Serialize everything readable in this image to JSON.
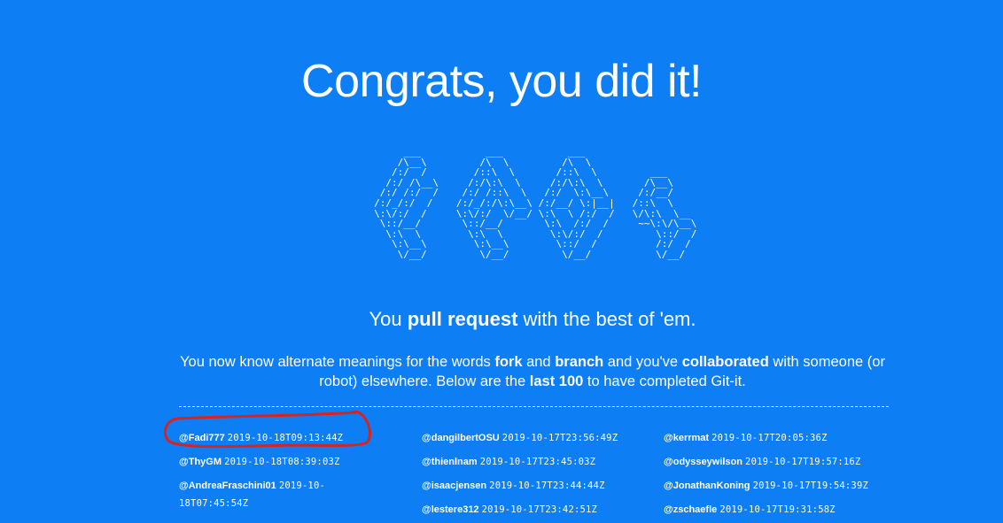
{
  "title": "Congrats, you did it!",
  "ascii_art": "      ___           ___           ___                   \n     /\\__\\         /\\  \\         /\\  \\                  \n    /:/  /        /::\\  \\       /::\\  \\         ___     \n   /:/ /\\__\\     /:/\\:\\  \\     /:/\\:\\  \\       /\\__\\    \n  /:/ /:/  /    /:/ /::\\  \\   /:/  \\:\\__\\     /:/__/    \n /:/_/:/  /    /:/_/:/\\:\\__\\ /:/__/ \\:|__|   /::\\  \\    \n \\:\\/:/  /     \\:\\/:/  \\/__/ \\:\\  \\ /:/  /   \\/\\:\\  \\__ \n  \\::/__/       \\::/__/       \\:\\  /:/  /     ~~\\:\\/\\__\\\n   \\:\\  \\        \\:\\  \\        \\:\\/:/  /         \\::/  /\n    \\:\\__\\        \\:\\__\\        \\::/  /          /:/  / \n     \\/__/         \\/__/         \\/__/           \\/__/  ",
  "tagline": {
    "pre": "You ",
    "bold": "pull request",
    "post": " with the best of 'em."
  },
  "description": {
    "p1": "You now know alternate meanings for the words ",
    "b1": "fork",
    "p2": " and ",
    "b2": "branch",
    "p3": " and you've ",
    "b3": "collaborated",
    "p4": " with someone (or robot) elsewhere. Below are the ",
    "b4": "last 100",
    "p5": " to have completed Git-it."
  },
  "completions": {
    "col1": [
      {
        "user": "@Fadi777",
        "time": "2019-10-18T09:13:44Z"
      },
      {
        "user": "@ThyGM",
        "time": "2019-10-18T08:39:03Z"
      },
      {
        "user": "@AndreaFraschini01",
        "time": "2019-10-18T07:45:54Z"
      }
    ],
    "col2": [
      {
        "user": "@dangilbertOSU",
        "time": "2019-10-17T23:56:49Z"
      },
      {
        "user": "@thienlnam",
        "time": "2019-10-17T23:45:03Z"
      },
      {
        "user": "@isaacjensen",
        "time": "2019-10-17T23:44:44Z"
      },
      {
        "user": "@lestere312",
        "time": "2019-10-17T23:42:51Z"
      }
    ],
    "col3": [
      {
        "user": "@kerrmat",
        "time": "2019-10-17T20:05:36Z"
      },
      {
        "user": "@odysseywilson",
        "time": "2019-10-17T19:57:16Z"
      },
      {
        "user": "@JonathanKoning",
        "time": "2019-10-17T19:54:39Z"
      },
      {
        "user": "@zschaefle",
        "time": "2019-10-17T19:31:58Z"
      }
    ]
  },
  "colors": {
    "background": "#0d7ef4",
    "text": "#ffffff",
    "annotation": "#d9241e"
  }
}
